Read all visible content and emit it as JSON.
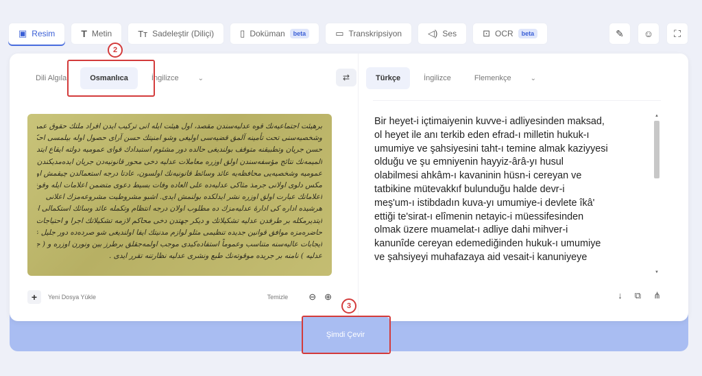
{
  "tabs": [
    {
      "label": "Resim",
      "icon": "image-icon",
      "glyph": "▣",
      "active": true,
      "badge": ""
    },
    {
      "label": "Metin",
      "icon": "text-icon",
      "glyph": "T",
      "active": false,
      "badge": ""
    },
    {
      "label": "Sadeleştir (Diliçi)",
      "icon": "simplify-icon",
      "glyph": "Tт",
      "active": false,
      "badge": ""
    },
    {
      "label": "Doküman",
      "icon": "document-icon",
      "glyph": "▯",
      "active": false,
      "badge": "beta"
    },
    {
      "label": "Transkripsiyon",
      "icon": "transcription-icon",
      "glyph": "▭",
      "active": false,
      "badge": ""
    },
    {
      "label": "Ses",
      "icon": "speaker-icon",
      "glyph": "◁)",
      "active": false,
      "badge": ""
    },
    {
      "label": "OCR",
      "icon": "ocr-icon",
      "glyph": "⊡",
      "active": false,
      "badge": "beta"
    }
  ],
  "top_actions": [
    {
      "name": "edit-icon",
      "glyph": "✎"
    },
    {
      "name": "smiley-icon",
      "glyph": "☺"
    },
    {
      "name": "fullscreen-icon",
      "glyph": "⛶"
    }
  ],
  "source_langs": {
    "detect": "Dili Algıla",
    "selected": "Osmanlıca",
    "other": "İngilizce",
    "chevron": "⌄"
  },
  "swap_glyph": "⇄",
  "target_langs": {
    "selected": "Türkçe",
    "items": [
      "İngilizce",
      "Flemenkçe"
    ],
    "chevron": "⌄"
  },
  "manuscript_lines": [
    "برهيئت اجتماعيه‌نك قوه عدليه‌سندن مقصد، اول هيئت ايله انى تركيب ايدن افراد ملتك حقوق عموميه",
    "وشخصيه‌سنى تحت تأمينه آلمق قضيه‌سى اوليغى وشو امنيتك حسن آرای حصول اوله بيلمسى احكام قوانينك",
    "حسن جريان وتطبيقنه متوقف بولنديغى حالده دور مشئوم استبدادك قواى عموميه دولته ايقاع ايتديكى تأثيرات",
    "الميمه‌نك نتائج مؤسفه‌سندن اولق اوزره معاملات عدليه دخى محور قانونيه‌دن جريان ايده‌مديكندن حقوق",
    "عموميه وشخصيه‌يى محافظه‌يه عائد وسائط قانونيه‌نك اولسون، عادتا درجه استعمالدن چيقمش اولمسيله",
    "مكس دلوى اولانى جرمذ مثاكى عدليه‌ده على العاده وفات بسيط دعوى متضمن اعلامات ايله وقوع سطر",
    "اعلاماتك عبارت اولق اوزره نشر ايدلكده بولنمش ايدى. اشبو مشروطيت مشروعه‌مزك اعلانى",
    "هرشيده اداره كى ادارهٔ عدليه‌مزك ده مطلوب اولان درجه انتظام وتكمله عائد وسائك استكمالى ايجاب",
    "ايتديرمكله بر طرفدن عدليه تشكيلاتك و ديكر جهتدن دخى محاكم لازمه تشكيلاتك اجرا و احتياجات",
    "حاضره‌مزه موافق قوانين جديده تنظيمى مثلو لوازم مدنيتك ايفا اولنديغى شو صرده‌ده دور جليل عدليه‌نك",
    "ايجابات عاليه‌سنه متناسب وعموماً استفاده‌كيدى موجب اولمه‌جقلق برطرز بين ونورن اوزره و ( جريده",
    "عدليه ) نامنه بر جريده موقوته‌نك طبع ونشرى عدليه نظارتنه تقرر ايدى ."
  ],
  "left_footer": {
    "plus": "+",
    "upload": "Yeni Dosya Yükle",
    "clear": "Temizle",
    "zoom_out": "⊖",
    "zoom_in": "⊕"
  },
  "translation_lines": [
    "Bir heyet-i içtimaiyenin kuvve-i adliyesinden maksad,",
    "ol heyet ile anı terkib eden efrad-ı milletin hukuk-ı",
    "umumiye ve şahsiyesini taht-ı temine almak kaziyyesi",
    "olduğu ve şu emniyenin hayyiz-ârâ-yı husul",
    "olabilmesi ahkâm-ı kavaninin hüsn-i cereyan ve",
    "tatbikine mütevakkıf bulunduğu halde devr-i",
    "meş'um-ı istibdadın kuva-yı umumiye-i devlete îkâ'",
    "ettiği te'sirat-ı elîmenin netayic-i müessifesinden",
    "olmak üzere muamelat-ı adliye dahi mihver-i",
    "kanunîde cereyan edemediğinden hukuk-ı umumiye",
    "ve şahsiyeyi muhafazaya aid vesait-i kanuniyeye"
  ],
  "scroll_glyphs": {
    "up": "▲",
    "down": "▼"
  },
  "right_footer": [
    {
      "name": "download-icon",
      "glyph": "↓"
    },
    {
      "name": "copy-icon",
      "glyph": "⧉"
    },
    {
      "name": "share-icon",
      "glyph": "⋔"
    }
  ],
  "translate_button": "Şimdi Çevir",
  "annotations": [
    "2",
    "3"
  ],
  "colors": {
    "accent": "#3a5fd6",
    "band": "#a9bdf2",
    "annotation": "#d33a3a"
  }
}
